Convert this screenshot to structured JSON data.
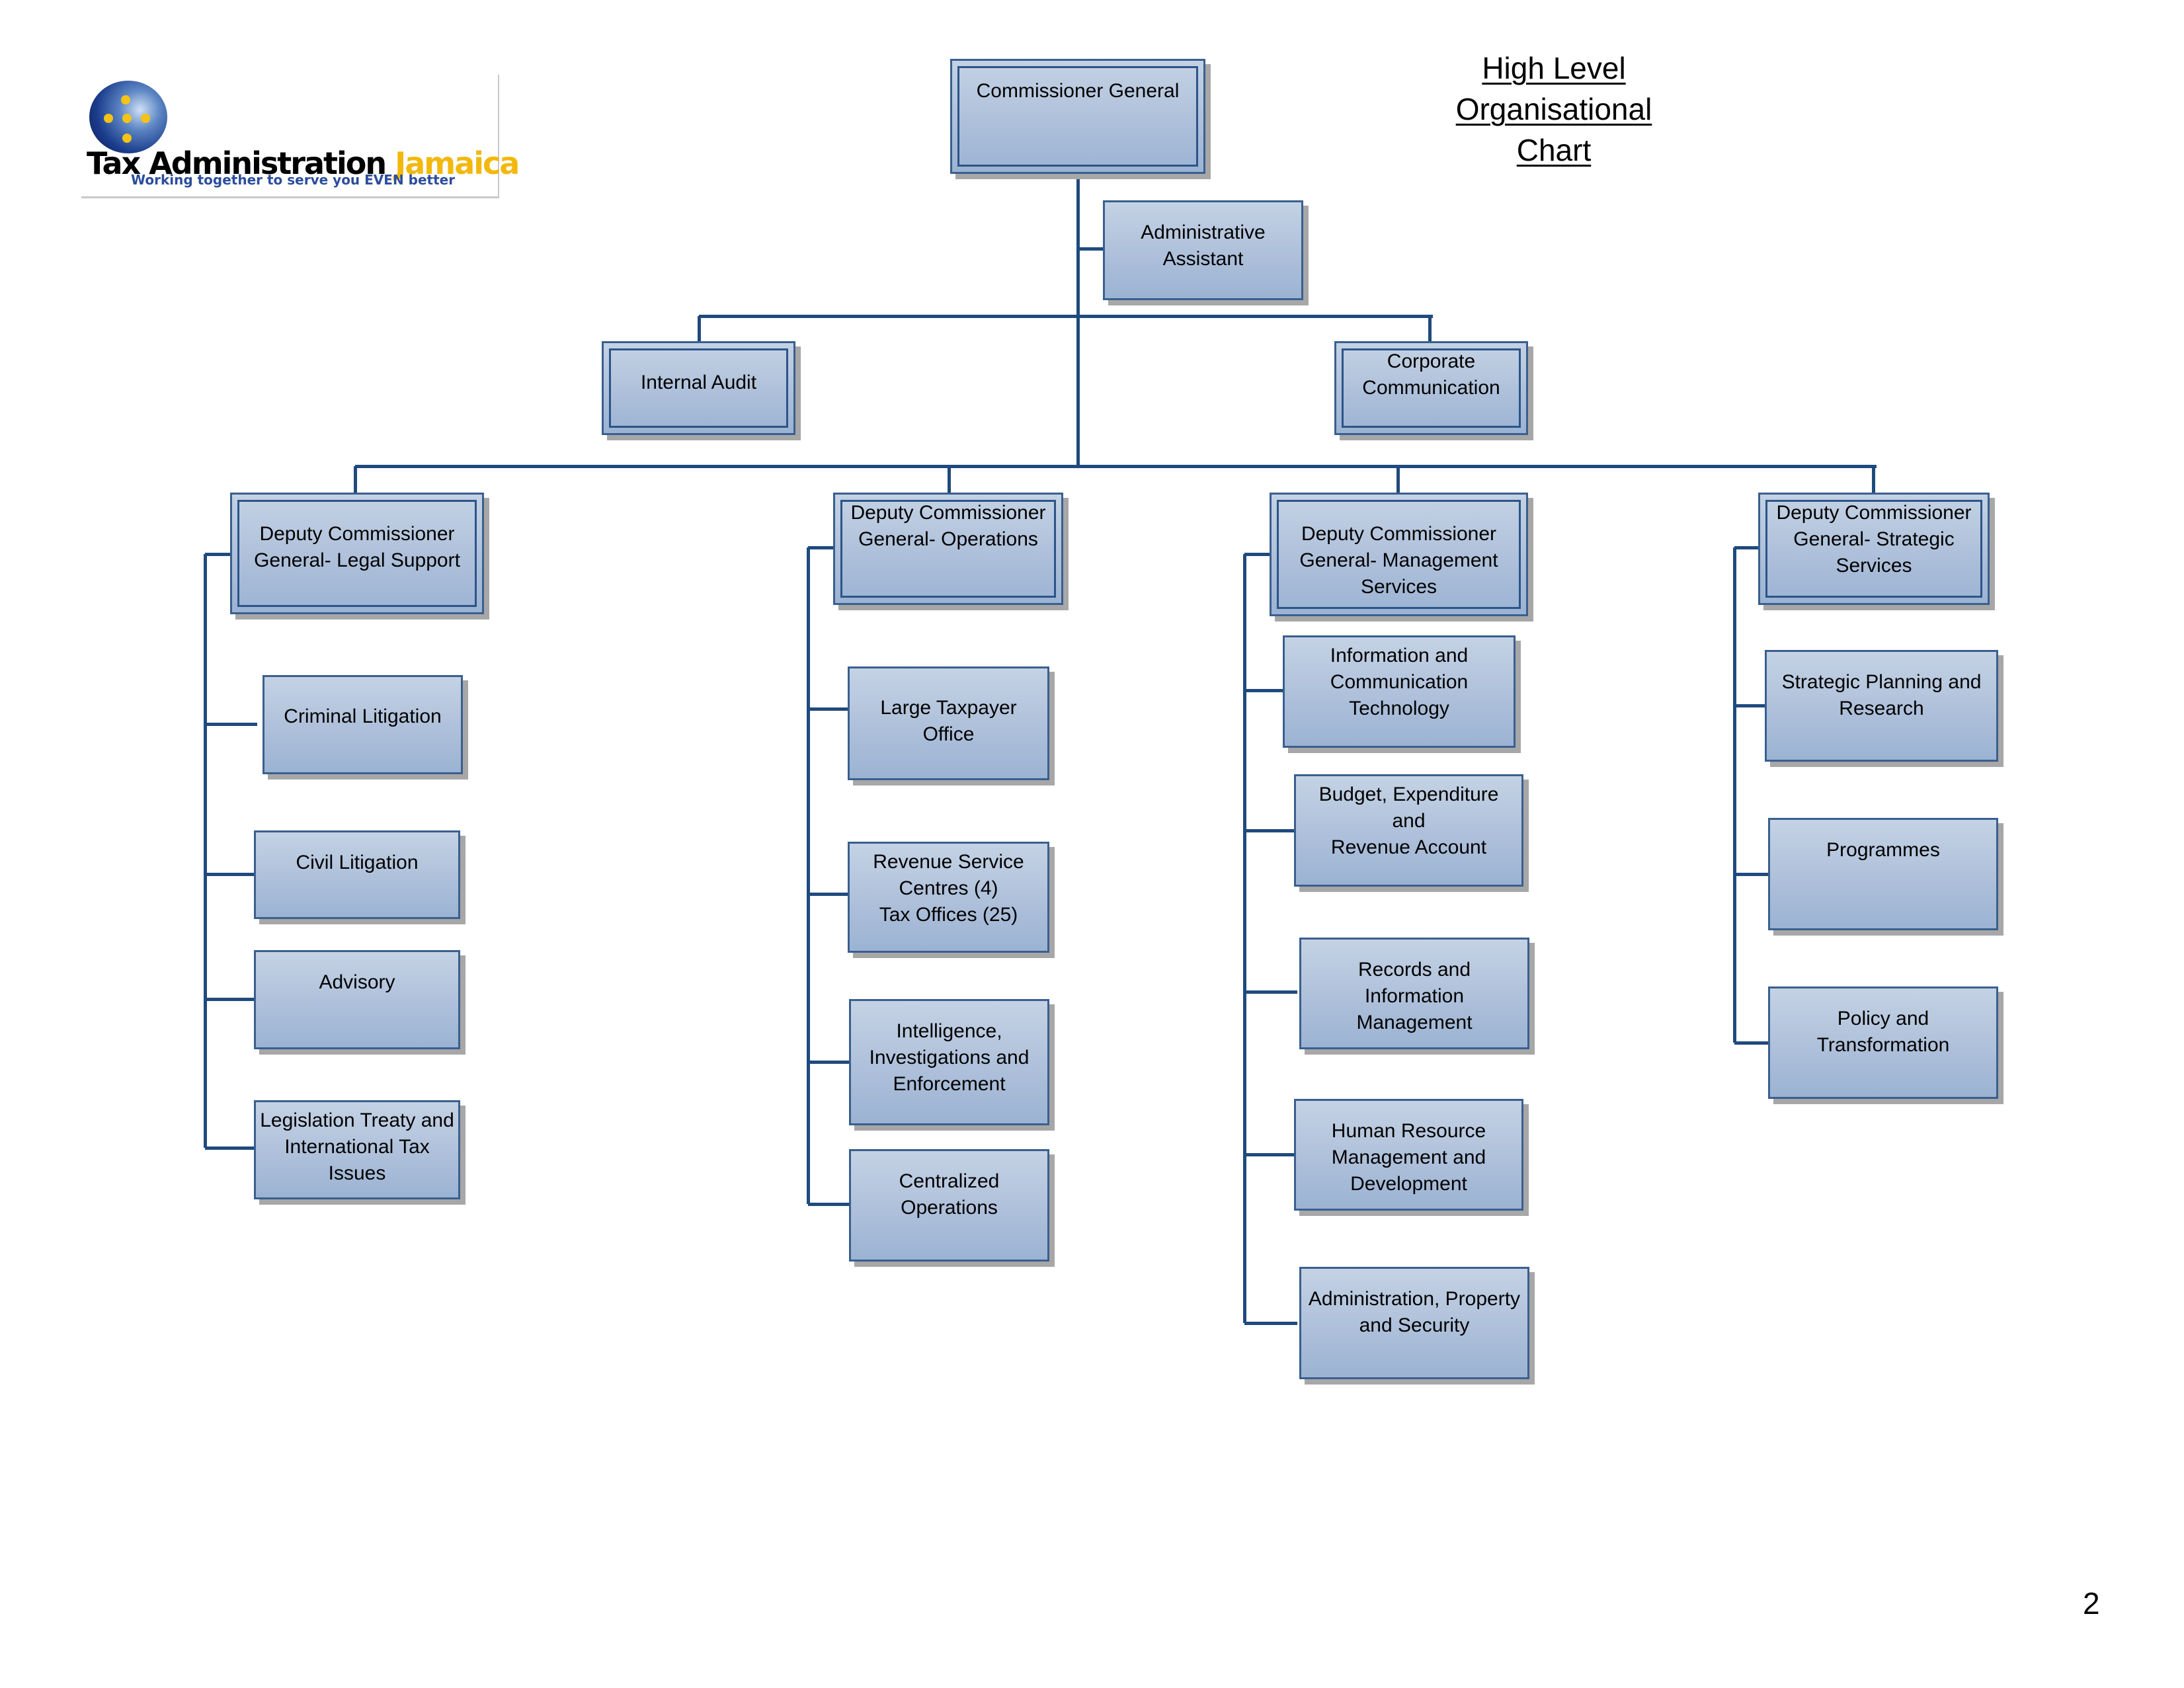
{
  "page": {
    "title_line1": "High Level Organisational",
    "title_line2": "Chart",
    "page_number": "2",
    "line_color": "#1f4a7e",
    "box_color": "#aec0da"
  },
  "logo": {
    "icon": "globe-icon",
    "name_part1": "Tax Administration ",
    "name_part2": "Jamaica",
    "tagline": "Working together to serve you EVEN better"
  },
  "org": {
    "commissioner_general": "Commissioner General",
    "administrative_assistant": "Administrative\nAssistant",
    "internal_audit": "Internal Audit",
    "corporate_communication": "Corporate\nCommunication",
    "divisions": [
      {
        "head": "Deputy Commissioner\nGeneral- Legal Support",
        "units": [
          "Criminal Litigation",
          "Civil Litigation",
          "Advisory",
          "Legislation Treaty and\nInternational Tax\nIssues"
        ]
      },
      {
        "head": "Deputy Commissioner\nGeneral- Operations",
        "units": [
          "Large Taxpayer Office",
          "Revenue Service\nCentres (4)\nTax Offices (25)",
          "Intelligence,\nInvestigations and\nEnforcement",
          "Centralized\nOperations"
        ]
      },
      {
        "head": "Deputy Commissioner\nGeneral- Management\nServices",
        "units": [
          "Information and\nCommunication\nTechnology",
          "Budget, Expenditure and\nRevenue Account",
          "Records and\nInformation\nManagement",
          "Human Resource\nManagement and\nDevelopment",
          "Administration, Property\nand Security"
        ]
      },
      {
        "head": "Deputy Commissioner\nGeneral- Strategic\nServices",
        "units": [
          "Strategic Planning and\nResearch",
          "Programmes",
          "Policy and\nTransformation"
        ]
      }
    ]
  }
}
